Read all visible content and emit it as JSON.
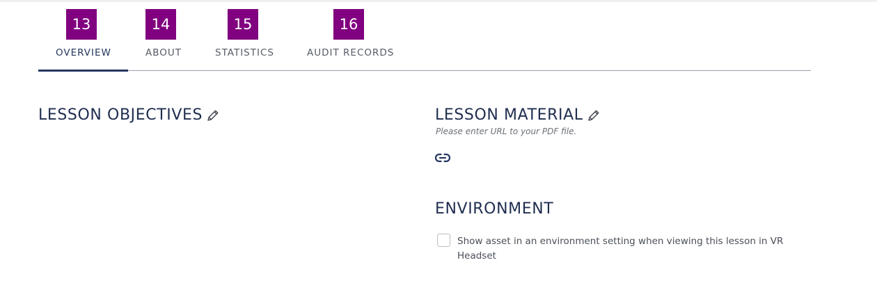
{
  "tabs": [
    {
      "badge": "13",
      "label": "OVERVIEW",
      "active": true
    },
    {
      "badge": "14",
      "label": "ABOUT",
      "active": false
    },
    {
      "badge": "15",
      "label": "STATISTICS",
      "active": false
    },
    {
      "badge": "16",
      "label": "AUDIT RECORDS",
      "active": false
    }
  ],
  "lesson_objectives": {
    "title": "LESSON OBJECTIVES",
    "edit_icon": "pencil-icon"
  },
  "lesson_material": {
    "title": "LESSON MATERIAL",
    "edit_icon": "pencil-icon",
    "hint": "Please enter URL to your PDF file.",
    "link_icon": "link-icon"
  },
  "environment": {
    "title": "ENVIRONMENT",
    "checkbox_label": "Show asset in an environment setting when viewing this lesson in VR Headset",
    "checked": false
  },
  "colors": {
    "badge_bg": "#800080",
    "navy": "#24365e",
    "divider": "#9aa0a8"
  }
}
